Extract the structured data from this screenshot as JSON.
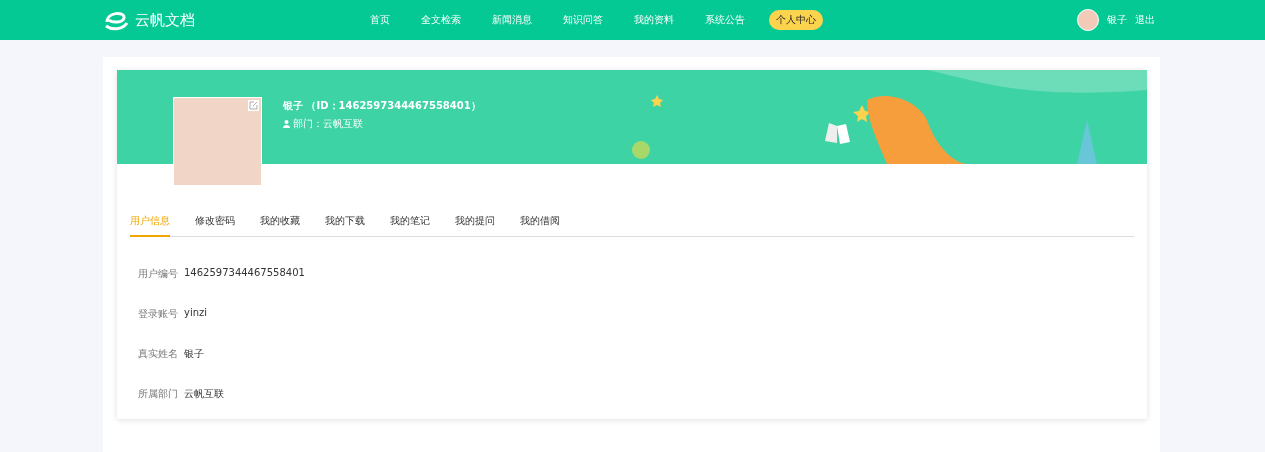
{
  "brand": {
    "name": "云帆文档"
  },
  "nav": [
    {
      "label": "首页",
      "selected": false
    },
    {
      "label": "全文检索",
      "selected": false
    },
    {
      "label": "新闻消息",
      "selected": false
    },
    {
      "label": "知识问答",
      "selected": false
    },
    {
      "label": "我的资料",
      "selected": false
    },
    {
      "label": "系统公告",
      "selected": false
    },
    {
      "label": "个人中心",
      "selected": true
    }
  ],
  "user": {
    "name": "银子",
    "logout": "退出"
  },
  "profile": {
    "title": "银子 （ID：1462597344467558401）",
    "department": "部门：云帆互联"
  },
  "tabs": [
    {
      "label": "用户信息",
      "selected": true
    },
    {
      "label": "修改密码",
      "selected": false
    },
    {
      "label": "我的收藏",
      "selected": false
    },
    {
      "label": "我的下载",
      "selected": false
    },
    {
      "label": "我的笔记",
      "selected": false
    },
    {
      "label": "我的提问",
      "selected": false
    },
    {
      "label": "我的借阅",
      "selected": false
    }
  ],
  "fields": [
    {
      "label": "用户编号",
      "value": "1462597344467558401"
    },
    {
      "label": "登录账号",
      "value": "yinzi"
    },
    {
      "label": "真实姓名",
      "value": "银子"
    },
    {
      "label": "所属部门",
      "value": "云帆互联"
    }
  ]
}
